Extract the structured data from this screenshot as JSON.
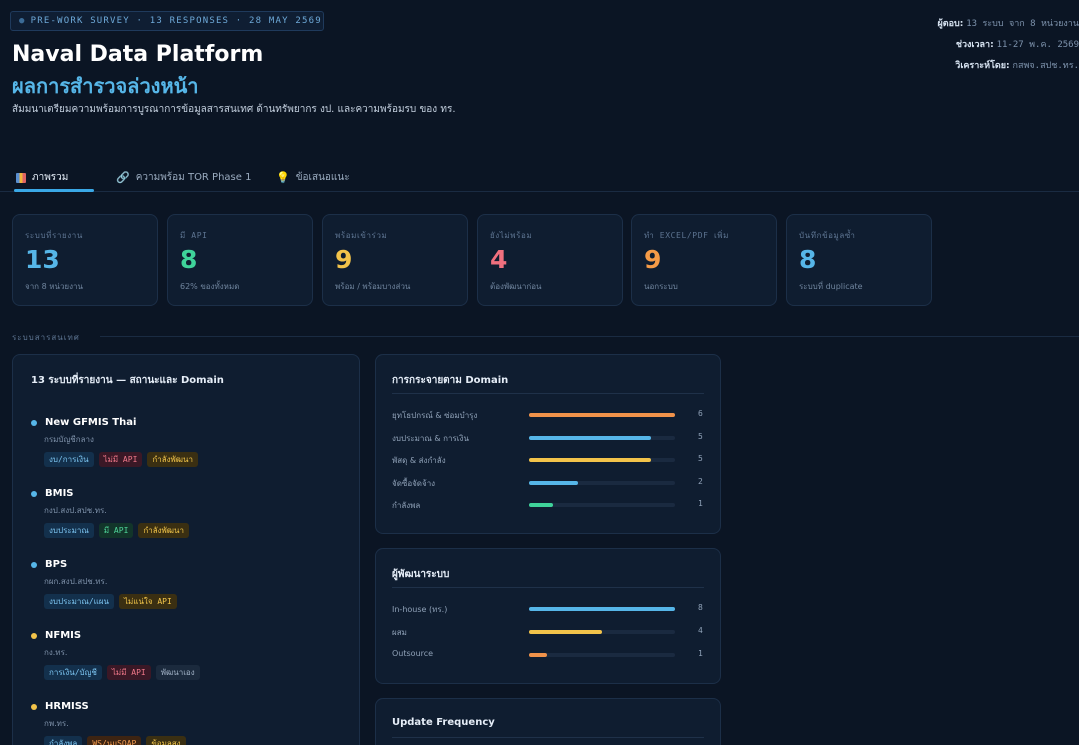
{
  "header": {
    "survey_tag": "PRE-WORK SURVEY · 13 RESPONSES · 28 MAY 2569",
    "title": "Naval Data Platform",
    "subtitle": "ผลการสำรวจล่วงหน้า",
    "description": "สัมมนาเตรียมความพร้อมการบูรณาการข้อมูลสารสนเทศ ด้านทรัพยากร งป. และความพร้อมรบ ของ ทร."
  },
  "meta": {
    "respondents_label": "ผู้ตอบ:",
    "respondents_value": "13 ระบบ จาก 8 หน่วยงาน",
    "period_label": "ช่วงเวลา:",
    "period_value": "11-27 พ.ค. 2569",
    "analyzed_label": "วิเคราะห์โดย:",
    "analyzed_value": "กสพจ.สปช.ทร."
  },
  "tabs": [
    {
      "label": "ภาพรวม",
      "icon": "bar-chart-icon",
      "active": true
    },
    {
      "label": "ความพร้อม TOR Phase 1",
      "icon": "link-icon",
      "active": false
    },
    {
      "label": "ข้อเสนอแนะ",
      "icon": "lightbulb-icon",
      "active": false
    }
  ],
  "stats": [
    {
      "label": "ระบบที่รายงาน",
      "value": "13",
      "sub": "จาก 8 หน่วยงาน",
      "color": "#56b6e8"
    },
    {
      "label": "มี API",
      "value": "8",
      "sub": "62% ของทั้งหมด",
      "color": "#3fd39a"
    },
    {
      "label": "พร้อมเข้าร่วม",
      "value": "9",
      "sub": "พร้อม / พร้อมบางส่วน",
      "color": "#f2c34a"
    },
    {
      "label": "ยังไม่พร้อม",
      "value": "4",
      "sub": "ต้องพัฒนาก่อน",
      "color": "#f0707e"
    },
    {
      "label": "ทำ EXCEL/PDF เพิ่ม",
      "value": "9",
      "sub": "นอกระบบ",
      "color": "#f59b47"
    },
    {
      "label": "บันทึกข้อมูลซ้ำ",
      "value": "8",
      "sub": "ระบบที่ duplicate",
      "color": "#56b6e8"
    }
  ],
  "section_label": "ระบบสารสนเทศ",
  "systems_panel": {
    "title": "13 ระบบที่รายงาน — สถานะและ Domain",
    "items": [
      {
        "name": "New GFMIS Thai",
        "org": "กรมบัญชีกลาง",
        "dot": "#56b6e8",
        "tags": [
          {
            "text": "งบ/การเงิน",
            "style": "t-blue"
          },
          {
            "text": "ไม่มี API",
            "style": "t-red"
          },
          {
            "text": "กำลังพัฒนา",
            "style": "t-yellow"
          }
        ]
      },
      {
        "name": "BMIS",
        "org": "กงป.สงป.สปช.ทร.",
        "dot": "#56b6e8",
        "tags": [
          {
            "text": "งบประมาณ",
            "style": "t-blue"
          },
          {
            "text": "มี API",
            "style": "t-green"
          },
          {
            "text": "กำลังพัฒนา",
            "style": "t-yellow"
          }
        ]
      },
      {
        "name": "BPS",
        "org": "กผก.สงป.สปช.ทร.",
        "dot": "#56b6e8",
        "tags": [
          {
            "text": "งบประมาณ/แผน",
            "style": "t-blue"
          },
          {
            "text": "ไม่แน่ใจ API",
            "style": "t-yellow"
          }
        ]
      },
      {
        "name": "NFMIS",
        "org": "กง.ทร.",
        "dot": "#f2c34a",
        "tags": [
          {
            "text": "การเงิน/บัญชี",
            "style": "t-blue"
          },
          {
            "text": "ไม่มี API",
            "style": "t-red"
          },
          {
            "text": "พัฒนาเอง",
            "style": "t-gray"
          }
        ]
      },
      {
        "name": "HRMISS",
        "org": "กพ.ทร.",
        "dot": "#f2c34a",
        "tags": [
          {
            "text": "กำลังพล",
            "style": "t-blue"
          },
          {
            "text": "WS/นuSOAP",
            "style": "t-orange"
          },
          {
            "text": "ข้อมูลสูง",
            "style": "t-yellow"
          }
        ]
      }
    ]
  },
  "domain_panel": {
    "title": "การกระจายตาม Domain",
    "max": 6,
    "rows": [
      {
        "label": "ยุทโธปกรณ์ & ซ่อมบำรุง",
        "value": 6,
        "color": "#f0924a"
      },
      {
        "label": "งบประมาณ & การเงิน",
        "value": 5,
        "color": "#56b6e8"
      },
      {
        "label": "พัสดุ & ส่งกำลัง",
        "value": 5,
        "color": "#f2c34a"
      },
      {
        "label": "จัดซื้อจัดจ้าง",
        "value": 2,
        "color": "#56b6e8"
      },
      {
        "label": "กำลังพล",
        "value": 1,
        "color": "#3fd39a"
      }
    ]
  },
  "developer_panel": {
    "title": "ผู้พัฒนาระบบ",
    "max": 8,
    "rows": [
      {
        "label": "In-house (ทร.)",
        "value": 8,
        "color": "#56b6e8"
      },
      {
        "label": "ผสม",
        "value": 4,
        "color": "#f2c34a"
      },
      {
        "label": "Outsource",
        "value": 1,
        "color": "#f0924a"
      }
    ]
  },
  "frequency_panel": {
    "title": "Update Frequency"
  }
}
